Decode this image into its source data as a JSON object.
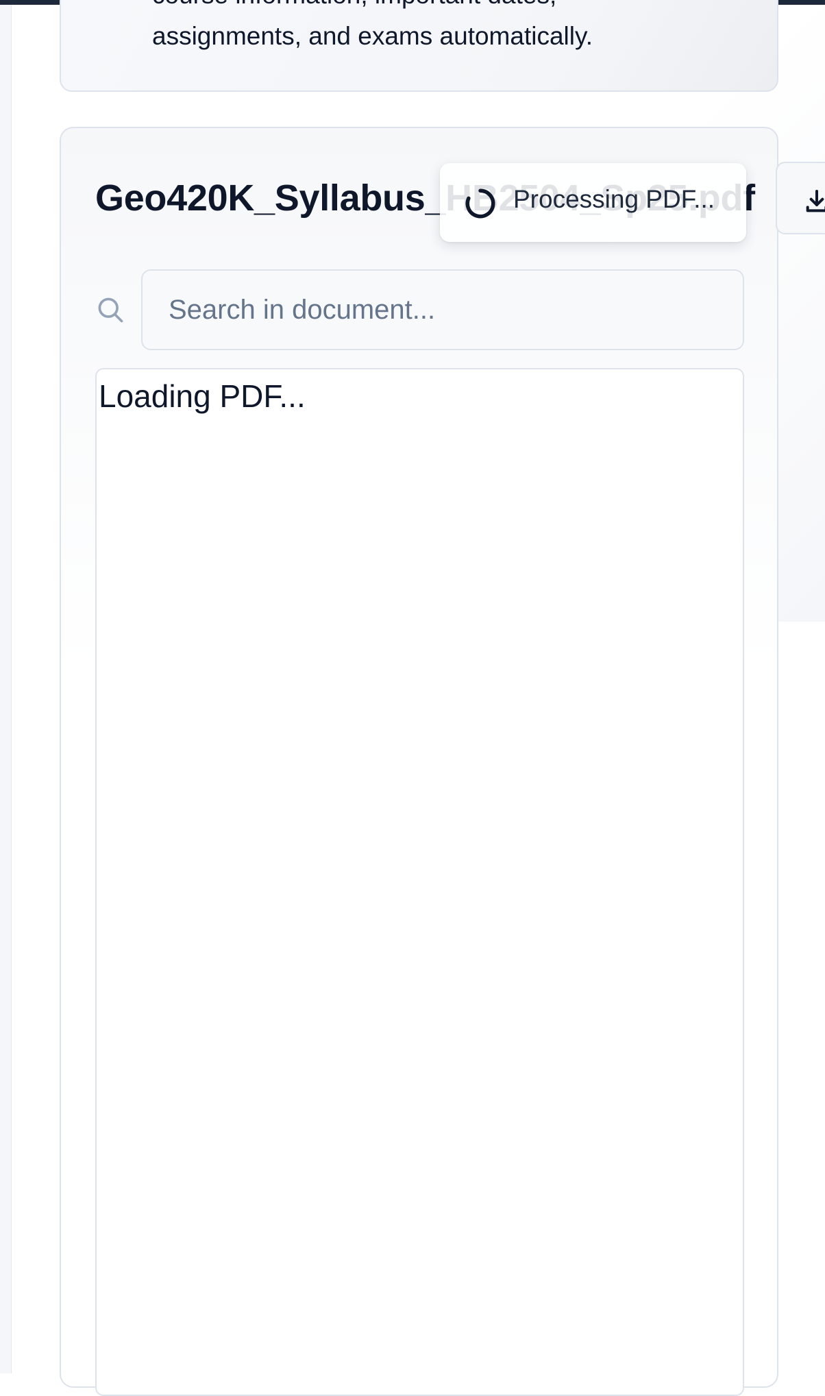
{
  "info_card": {
    "line1": "course information, important dates,",
    "line2": "assignments, and exams automatically."
  },
  "document": {
    "file_name": "Geo420K_Syllabus_HB2504_Sp25.pdf",
    "download_icon": "download-icon"
  },
  "toast": {
    "icon": "spinner-icon",
    "message": "Processing PDF..."
  },
  "search": {
    "icon": "search-icon",
    "placeholder": "Search in document..."
  },
  "viewer": {
    "status": "Loading PDF..."
  },
  "colors": {
    "text_primary": "#0f172a",
    "placeholder": "#64748b",
    "border": "#dde3ec",
    "top_bar": "#1e293b"
  }
}
